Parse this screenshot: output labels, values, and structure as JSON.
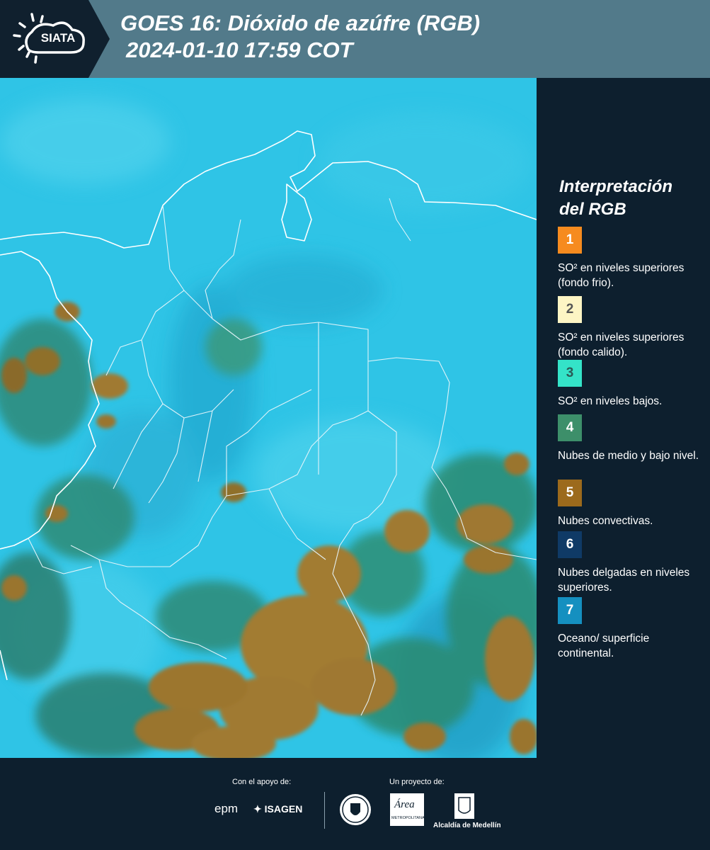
{
  "header": {
    "logo_text": "SIATA",
    "title_line1": "GOES 16: Dióxido de azúfre (RGB)",
    "title_line2": "2024-01-10 17:59 COT"
  },
  "map": {
    "description_icon": "satellite-map"
  },
  "legend": {
    "title": "Interpretación del RGB",
    "items": [
      {
        "number": "1",
        "color": "#f68b1f",
        "text_color": "#ffffff",
        "label": "SO² en niveles superiores (fondo frio)."
      },
      {
        "number": "2",
        "color": "#fdf5c4",
        "text_color": "#555555",
        "label": "SO² en niveles superiores (fondo calido)."
      },
      {
        "number": "3",
        "color": "#34e3c8",
        "text_color": "#2a5a55",
        "label": "SO² en niveles bajos."
      },
      {
        "number": "4",
        "color": "#3d8f6a",
        "text_color": "#ffffff",
        "label": "Nubes de medio y bajo nivel."
      },
      {
        "number": "5",
        "color": "#9c6a1c",
        "text_color": "#ffffff",
        "label": "Nubes convectivas."
      },
      {
        "number": "6",
        "color": "#0f3a66",
        "text_color": "#ffffff",
        "label": "Nubes delgadas en niveles superiores."
      },
      {
        "number": "7",
        "color": "#1590c0",
        "text_color": "#ffffff",
        "label": "Oceano/ superficie continental."
      }
    ]
  },
  "footer": {
    "support_label": "Con el apoyo de:",
    "project_label": "Un proyecto de:",
    "sponsor_epm": "epm",
    "sponsor_isagen": "ISAGEN",
    "area_text": "Área",
    "area_sub": "METROPOLITANA",
    "alcaldia": "Alcaldía de Medellín"
  }
}
